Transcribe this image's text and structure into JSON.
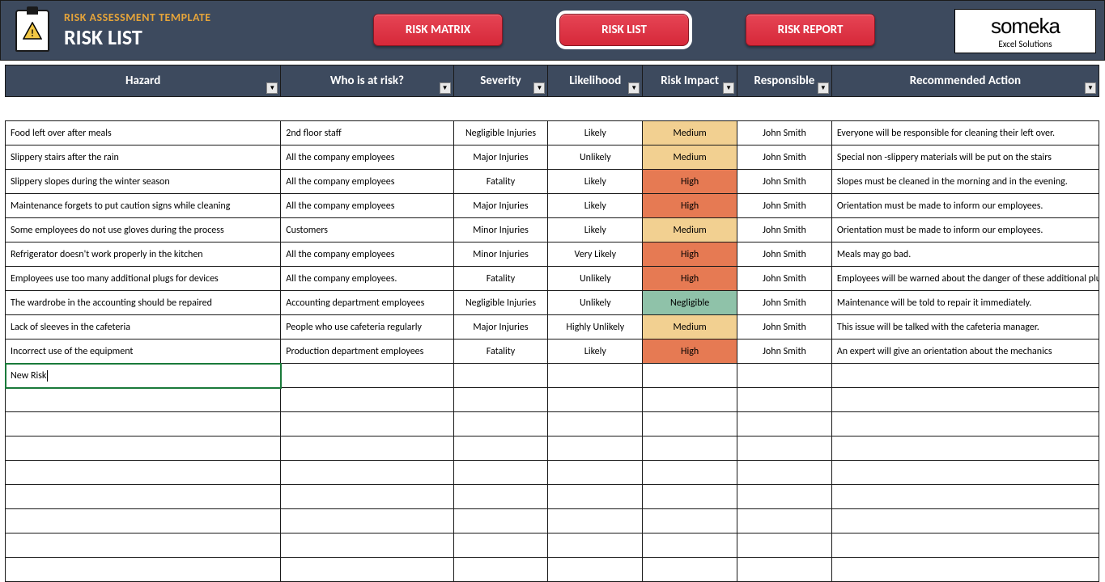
{
  "header": {
    "supertitle": "RISK ASSESSMENT TEMPLATE",
    "title": "RISK LIST"
  },
  "nav": {
    "matrix": "RISK MATRIX",
    "list": "RISK LIST",
    "report": "RISK REPORT"
  },
  "brand": {
    "name": "someka",
    "sub": "Excel Solutions"
  },
  "columns": {
    "hazard": "Hazard",
    "who": "Who is at risk?",
    "severity": "Severity",
    "likelihood": "Likelihood",
    "impact": "Risk Impact",
    "responsible": "Responsible",
    "action": "Recommended Action"
  },
  "impact_labels": {
    "medium": "Medium",
    "high": "High",
    "negligible": "Negligible"
  },
  "editing_cell_value": "New Risk",
  "rows": [
    {
      "hazard": "Food left over after meals",
      "who": "2nd floor staff",
      "severity": "Negligible Injuries",
      "likelihood": "Likely",
      "impact": "medium",
      "responsible": "John Smith",
      "action": "Everyone will be responsible for cleaning their left over."
    },
    {
      "hazard": "Slippery stairs after the rain",
      "who": "All the company employees",
      "severity": "Major Injuries",
      "likelihood": "Unlikely",
      "impact": "medium",
      "responsible": "John Smith",
      "action": "Special non -slippery materials will be put on the stairs"
    },
    {
      "hazard": "Slippery slopes during the winter season",
      "who": "All the company employees",
      "severity": "Fatality",
      "likelihood": "Likely",
      "impact": "high",
      "responsible": "John Smith",
      "action": "Slopes must be cleaned in the morning and in the evening."
    },
    {
      "hazard": "Maintenance forgets to put caution signs while cleaning",
      "who": "All the company employees",
      "severity": "Major Injuries",
      "likelihood": "Likely",
      "impact": "high",
      "responsible": "John Smith",
      "action": "Orientation must be made to inform our employees."
    },
    {
      "hazard": "Some employees do not use gloves during the process",
      "who": "Customers",
      "severity": "Minor Injuries",
      "likelihood": "Likely",
      "impact": "medium",
      "responsible": "John Smith",
      "action": "Orientation must be made to inform our employees."
    },
    {
      "hazard": "Refrigerator doesn't work properly in the kitchen",
      "who": "All the company employees",
      "severity": "Minor Injuries",
      "likelihood": "Very Likely",
      "impact": "high",
      "responsible": "John Smith",
      "action": "Meals may go bad."
    },
    {
      "hazard": "Employees use too many additional plugs for  devices",
      "who": "All the company employees.",
      "severity": "Fatality",
      "likelihood": "Unlikely",
      "impact": "high",
      "responsible": "John Smith",
      "action": "Employees will be warned about the danger of these additional plugs.",
      "small": true
    },
    {
      "hazard": "The wardrobe in the accounting should be repaired",
      "who": "Accounting department employees",
      "severity": "Negligible Injuries",
      "likelihood": "Unlikely",
      "impact": "negligible",
      "responsible": "John Smith",
      "action": "Maintenance will be told to repair it immediately."
    },
    {
      "hazard": "Lack of sleeves in the cafeteria",
      "who": "People who use cafeteria regularly",
      "severity": "Major Injuries",
      "likelihood": "Highly Unlikely",
      "impact": "medium",
      "responsible": "John Smith",
      "action": "This issue will be talked with the cafeteria manager."
    },
    {
      "hazard": "Incorrect use of the equipment",
      "who": "Production department employees",
      "severity": "Fatality",
      "likelihood": "Likely",
      "impact": "high",
      "responsible": "John Smith",
      "action": "An expert will give an orientation about the mechanics"
    }
  ],
  "empty_rows_count": 8
}
